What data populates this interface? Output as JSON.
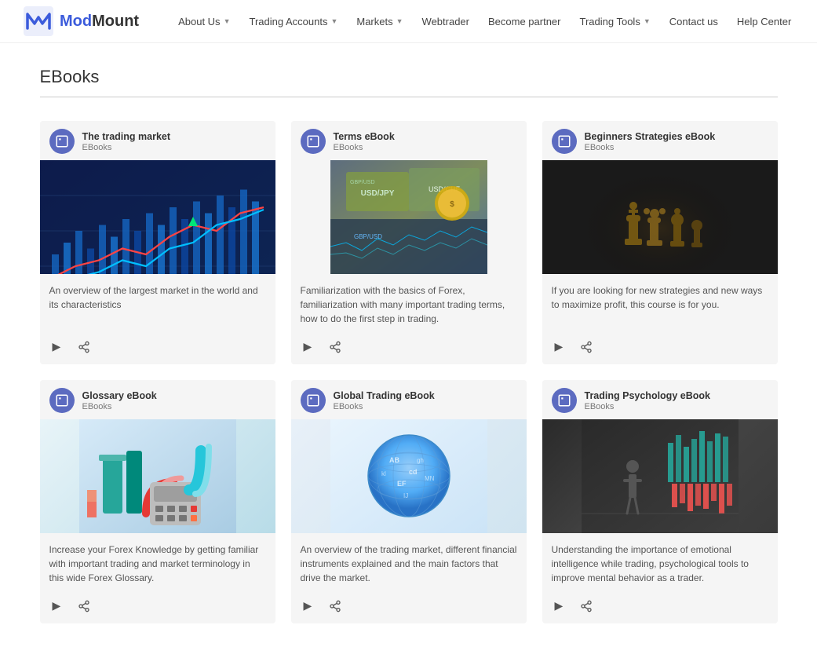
{
  "header": {
    "logo_mod": "Mod",
    "logo_mount": "Mount",
    "nav": [
      {
        "label": "About Us",
        "has_arrow": true,
        "name": "about-us"
      },
      {
        "label": "Trading Accounts",
        "has_arrow": true,
        "name": "trading-accounts"
      },
      {
        "label": "Markets",
        "has_arrow": true,
        "name": "markets"
      },
      {
        "label": "Webtrader",
        "has_arrow": false,
        "name": "webtrader"
      },
      {
        "label": "Become partner",
        "has_arrow": false,
        "name": "become-partner"
      },
      {
        "label": "Trading Tools",
        "has_arrow": true,
        "name": "trading-tools"
      },
      {
        "label": "Contact us",
        "has_arrow": false,
        "name": "contact-us"
      },
      {
        "label": "Help Center",
        "has_arrow": false,
        "name": "help-center"
      }
    ]
  },
  "page": {
    "title": "EBooks"
  },
  "cards": [
    {
      "id": "trading-market",
      "title": "The trading market",
      "category": "EBooks",
      "description": "An overview of the largest market in the world and its characteristics",
      "image_type": "trading-market"
    },
    {
      "id": "terms-ebook",
      "title": "Terms eBook",
      "category": "EBooks",
      "description": "Familiarization with the basics of Forex, familiarization with many important trading terms, how to do the first step in trading.",
      "image_type": "terms"
    },
    {
      "id": "beginners-strategies",
      "title": "Beginners Strategies eBook",
      "category": "EBooks",
      "description": "If you are looking for new strategies and new ways to maximize profit, this course is for you.",
      "image_type": "chess"
    },
    {
      "id": "glossary-ebook",
      "title": "Glossary eBook",
      "category": "EBooks",
      "description": "Increase your Forex Knowledge by getting familiar with important trading and market terminology in this wide Forex Glossary.",
      "image_type": "glossary"
    },
    {
      "id": "global-trading",
      "title": "Global Trading eBook",
      "category": "EBooks",
      "description": "An overview of the trading market, different financial instruments explained and the main factors that drive the market.",
      "image_type": "global"
    },
    {
      "id": "trading-psychology",
      "title": "Trading Psychology eBook",
      "category": "EBooks",
      "description": "Understanding the importance of emotional intelligence while trading, psychological tools to improve mental behavior as a trader.",
      "image_type": "psychology"
    }
  ],
  "icons": {
    "play": "▶",
    "share": "⤢"
  }
}
